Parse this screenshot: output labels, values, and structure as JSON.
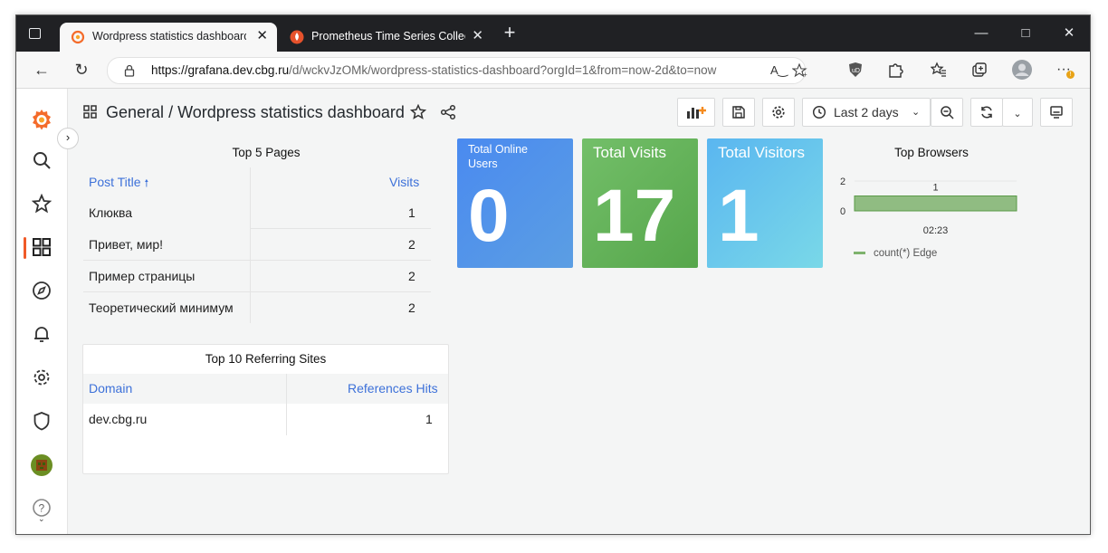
{
  "browser": {
    "tabs": [
      {
        "title": "Wordpress statistics dashboard - ",
        "close": "✕"
      },
      {
        "title": "Prometheus Time Series Collectio",
        "close": "✕"
      }
    ],
    "new_tab": "+",
    "url_host": "https://grafana.dev.cbg.ru",
    "url_path": "/d/wckvJzOMk/wordpress-statistics-dashboard?orgId=1&from=now-2d&to=now"
  },
  "dashboard": {
    "folder": "General",
    "separator": "/",
    "title": "Wordpress statistics dashboard",
    "time_range": "Last 2 days"
  },
  "top_pages": {
    "title": "Top 5 Pages",
    "headers": {
      "post_title": "Post Title",
      "visits": "Visits"
    },
    "rows": [
      {
        "title": "Клюква",
        "visits": "1"
      },
      {
        "title": "Привет, мир!",
        "visits": "2"
      },
      {
        "title": "Пример страницы",
        "visits": "2"
      },
      {
        "title": "Теоретический минимум",
        "visits": "2"
      }
    ]
  },
  "referring_sites": {
    "title": "Top 10 Referring Sites",
    "headers": {
      "domain": "Domain",
      "hits": "References Hits"
    },
    "rows": [
      {
        "domain": "dev.cbg.ru",
        "hits": "1"
      }
    ]
  },
  "stats": {
    "online_users": {
      "title": "Total Online Users",
      "value": "0",
      "color_from": "#4a8af0",
      "color_to": "#5b9ee3"
    },
    "visits": {
      "title": "Total Visits",
      "value": "17",
      "color_from": "#73bf69",
      "color_to": "#56a64b"
    },
    "visitors": {
      "title": "Total Visitors",
      "value": "1",
      "color_from": "#5ab6f0",
      "color_to": "#79d8e8"
    }
  },
  "chart_data": {
    "type": "bar",
    "title": "Top Browsers",
    "categories": [
      "02:23"
    ],
    "series": [
      {
        "name": "count(*) Edge",
        "values": [
          1
        ],
        "color": "#7eb26d"
      }
    ],
    "y_ticks": [
      "2",
      "0"
    ],
    "ylim": [
      0,
      2
    ],
    "data_labels": [
      "1"
    ],
    "legend": "bottom-left"
  }
}
